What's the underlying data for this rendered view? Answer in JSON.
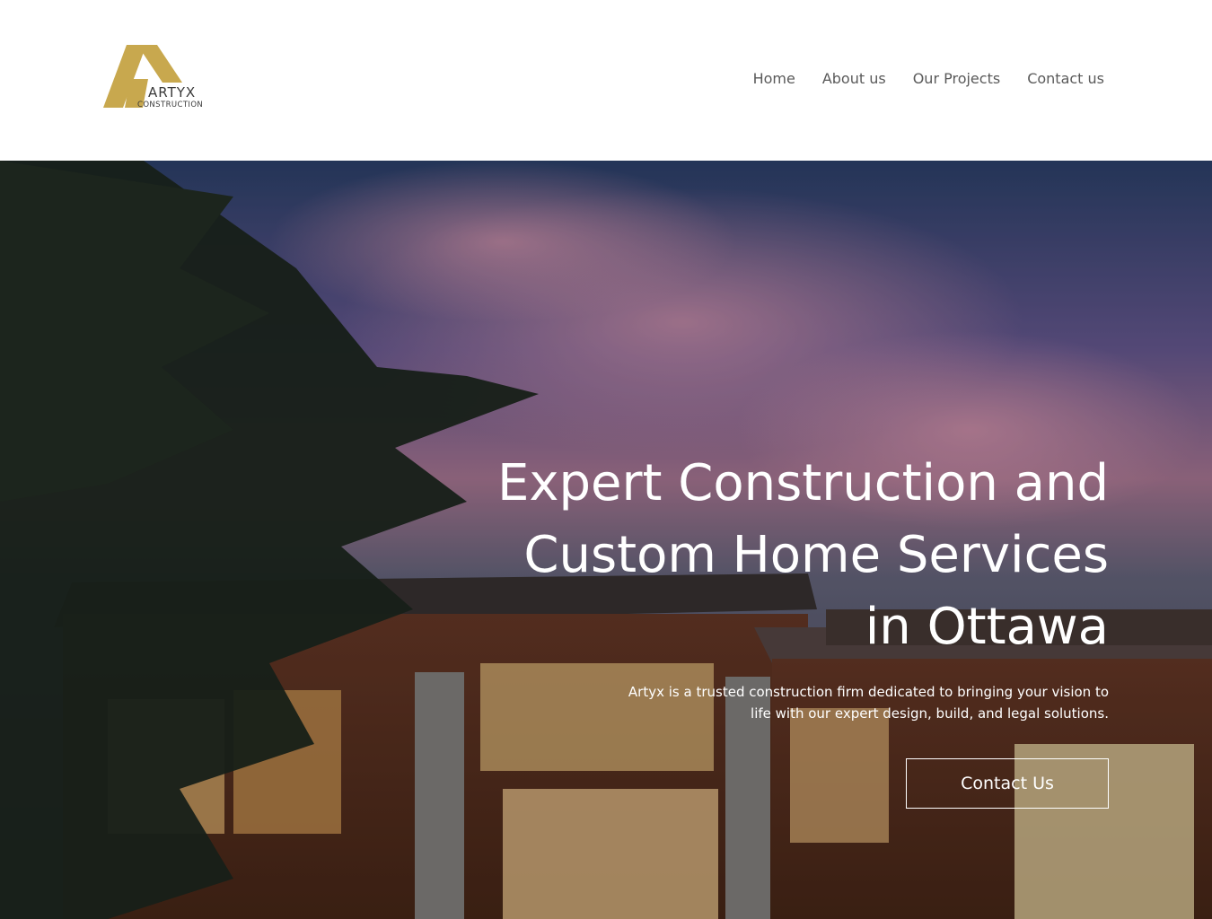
{
  "brand": {
    "name": "ARTYX",
    "sub": "CONSTRUCTION",
    "accent": "#c8a84e"
  },
  "nav": {
    "items": [
      {
        "label": "Home"
      },
      {
        "label": "About us"
      },
      {
        "label": "Our Projects"
      },
      {
        "label": "Contact us"
      }
    ]
  },
  "hero": {
    "title": "Expert Construction and Custom Home Services in Ottawa",
    "text": "Artyx is a trusted construction firm dedicated to bringing your vision to life with our expert design, build, and legal solutions.",
    "cta_label": "Contact Us"
  }
}
